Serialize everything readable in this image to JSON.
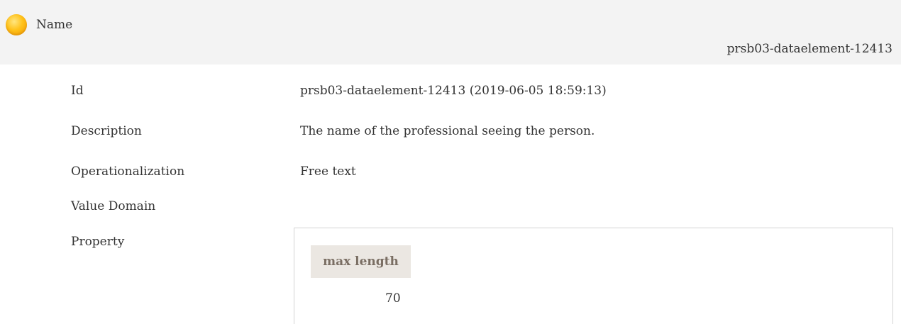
{
  "header": {
    "status_icon": "status-orange-circle-icon",
    "status_color": "#ffc21a",
    "title": "Name",
    "element_id": "prsb03-dataelement-12413"
  },
  "details": {
    "id_label": "Id",
    "id_value": "prsb03-dataelement-12413 (2019-06-05 18:59:13)",
    "description_label": "Description",
    "description_value": "The name of the professional seeing the person.",
    "operationalization_label": "Operationalization",
    "operationalization_value": "Free text",
    "value_domain_label": "Value Domain",
    "property_label": "Property"
  },
  "property_table": {
    "column_header": "max length",
    "value": "70"
  }
}
